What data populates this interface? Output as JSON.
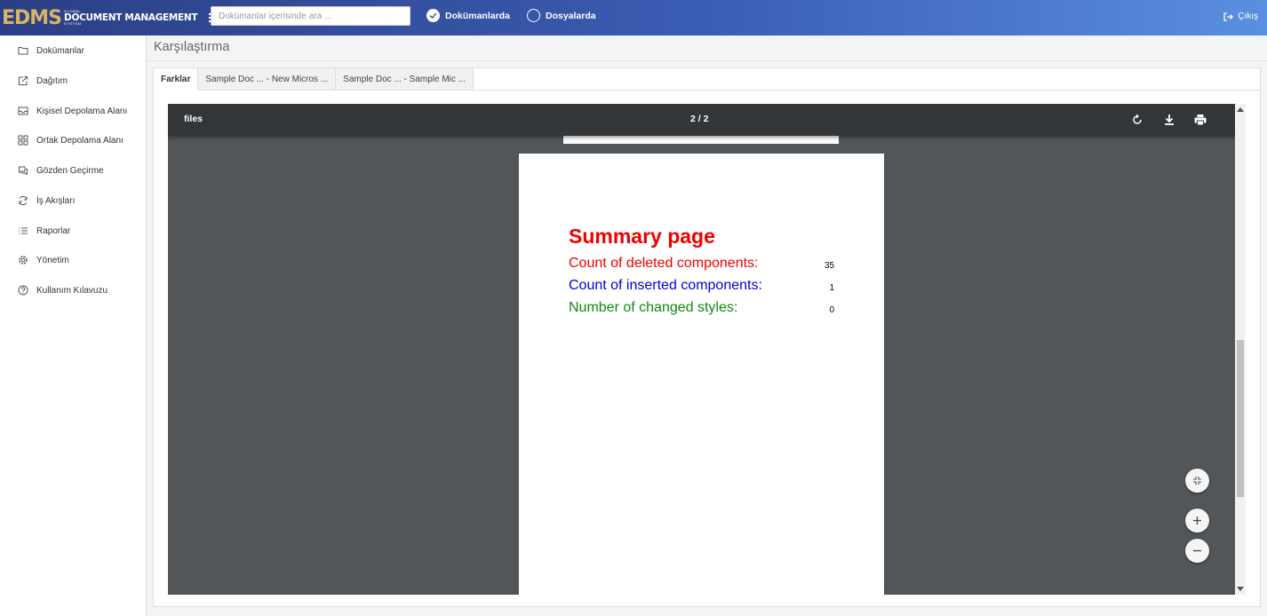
{
  "header": {
    "logo_main": "EDMS",
    "logo_small": "GLOBAL",
    "logo_big": "DOCUMENT MANAGEMENT",
    "logo_sub": "SYSTEM",
    "search_placeholder": "Dokümanlar içerisinde ara ...",
    "search_value": "",
    "radio_documents": "Dokümanlarda",
    "radio_files": "Dosyalarda",
    "radio_selected": "Dokümanlarda",
    "exit_label": "Çıkış"
  },
  "sidebar": {
    "items": [
      {
        "label": "Dokümanlar",
        "icon": "folder-icon"
      },
      {
        "label": "Dağıtım",
        "icon": "share-icon"
      },
      {
        "label": "Kişisel Depolama Alanı",
        "icon": "inbox-icon"
      },
      {
        "label": "Ortak Depolama Alanı",
        "icon": "grid-icon"
      },
      {
        "label": "Gözden Geçirme",
        "icon": "comments-icon"
      },
      {
        "label": "İş Akışları",
        "icon": "refresh-icon"
      },
      {
        "label": "Raporlar",
        "icon": "list-icon"
      },
      {
        "label": "Yönetim",
        "icon": "settings-icon"
      },
      {
        "label": "Kullanım Kılavuzu",
        "icon": "help-icon"
      }
    ]
  },
  "main": {
    "title": "Karşılaştırma",
    "tabs": [
      {
        "label": "Farklar",
        "active": true
      },
      {
        "label": "Sample Doc ... - New Micros ...",
        "active": false
      },
      {
        "label": "Sample Doc ... - Sample Mic ...",
        "active": false
      }
    ]
  },
  "viewer": {
    "title": "files",
    "page_indicator": "2 / 2",
    "summary": {
      "heading": "Summary page",
      "rows": [
        {
          "label": "Count of deleted components:",
          "value": "35",
          "color": "#ee0000"
        },
        {
          "label": "Count of inserted components:",
          "value": "1",
          "color": "#0000dd"
        },
        {
          "label": "Number of changed styles:",
          "value": "0",
          "color": "#118811"
        }
      ]
    }
  },
  "colors": {
    "header_start": "#2b3f83",
    "header_end": "#5a8fe0",
    "logo_gold": "#d8b46a",
    "viewer_bg": "#525659",
    "viewer_bar": "#323639"
  }
}
